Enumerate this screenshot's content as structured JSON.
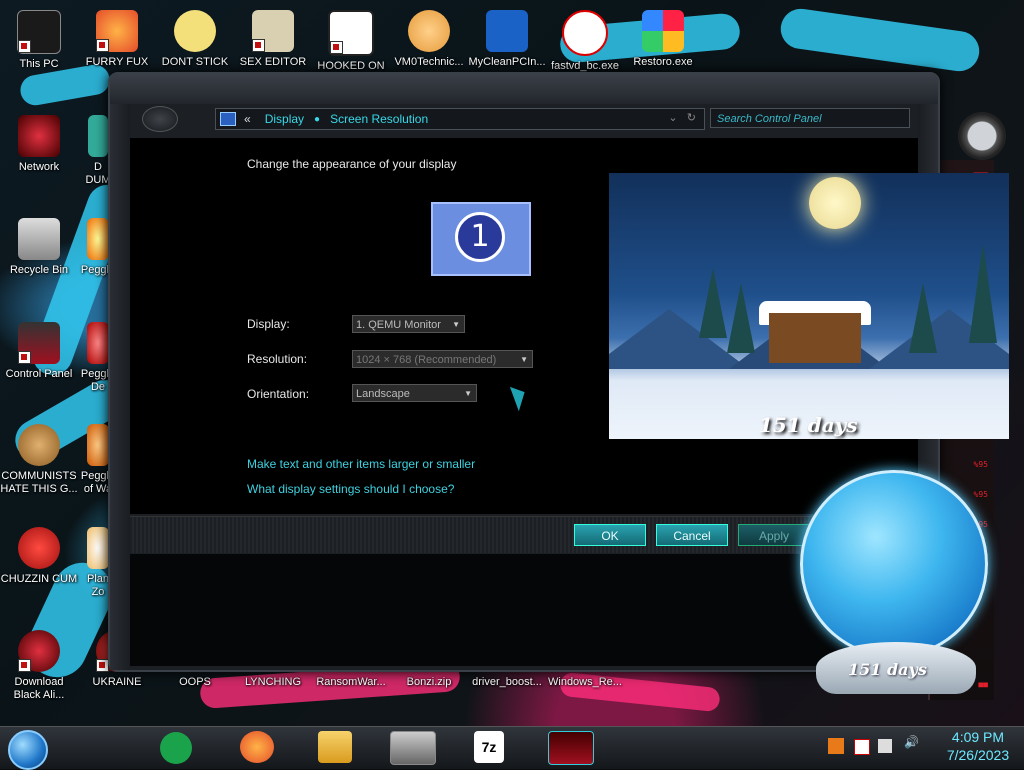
{
  "desktop": {
    "top_icons": [
      "This PC",
      "FURRY FUX",
      "DONT STICK",
      "SEX EDITOR",
      "HOOKED ON",
      "VM0Technic...",
      "MyCleanPCIn...",
      "fastvd_bc.exe",
      "Restoro.exe"
    ],
    "left_icons": [
      "Network",
      "Recycle Bin",
      "Control Panel",
      "COMMUNISTS HATE THIS G...",
      "CHUZZIN CUM",
      "Download Black Ali..."
    ],
    "col2_icons": [
      "D DUM",
      "Peggle",
      "Peggle De",
      "Peggle of Wa",
      "Plan Zo",
      "UKRAINE"
    ],
    "bottom_icons": [
      "OOPS",
      "LYNCHING",
      "RansomWar...",
      "Bonzi.zip",
      "driver_boost...",
      "Windows_Re..."
    ]
  },
  "window": {
    "breadcrumb": [
      "Display",
      "Screen Resolution"
    ],
    "search_placeholder": "Search Control Panel",
    "heading": "Change the appearance of your display",
    "monitor_number": "1",
    "display_label": "Display:",
    "display_value": "1. QEMU Monitor",
    "resolution_label": "Resolution:",
    "resolution_value": "1024 × 768 (Recommended)",
    "orientation_label": "Orientation:",
    "orientation_value": "Landscape",
    "link_text_size": "Make text and other items larger or smaller",
    "link_help": "What display settings should I choose?",
    "ok": "OK",
    "cancel": "Cancel",
    "apply": "Apply"
  },
  "widgets": {
    "countdown_days": "151 days",
    "globe_days": "151 days"
  },
  "taskbar": {
    "time": "4:09 PM",
    "date": "7/26/2023",
    "apps": [
      "spotify",
      "firefox",
      "file-explorer",
      "display-settings",
      "7zip",
      "alienware"
    ]
  },
  "colors": {
    "accent": "#3ed2e0",
    "button": "#1f8f9a"
  }
}
